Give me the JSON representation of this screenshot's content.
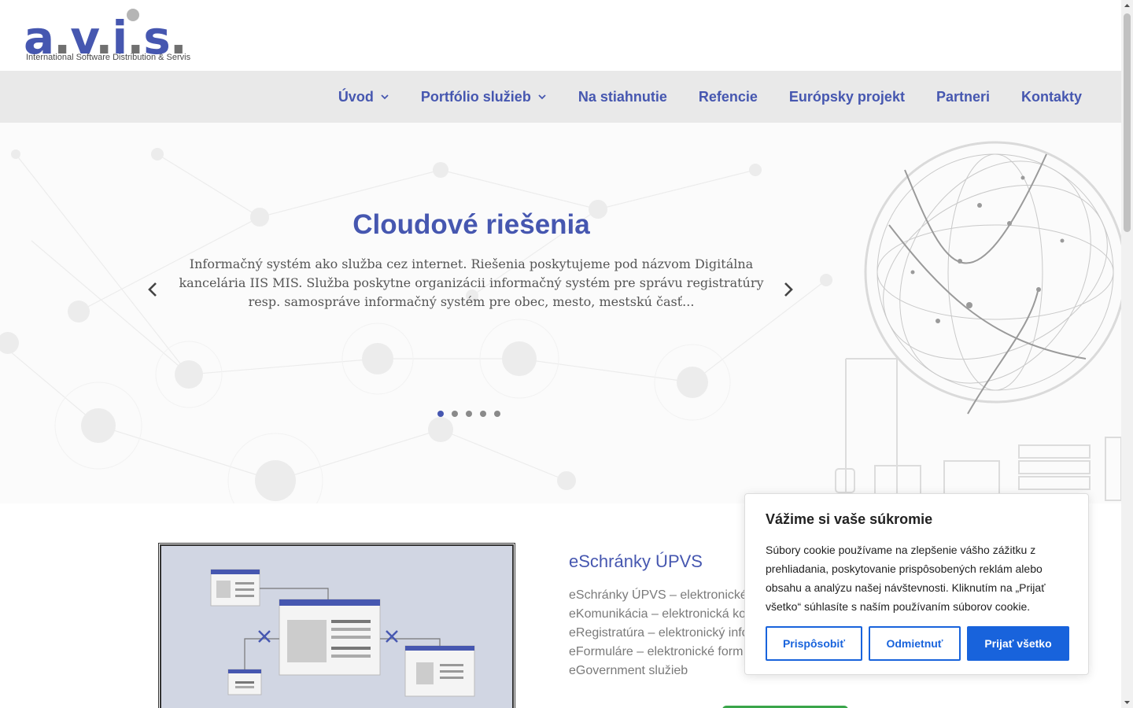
{
  "logo": {
    "letters": [
      "a",
      ".",
      "v",
      ".",
      "i",
      ".",
      "s",
      "."
    ],
    "tagline": "International Software Distribution & Servis"
  },
  "nav": {
    "items": [
      {
        "label": "Úvod",
        "dropdown": true
      },
      {
        "label": "Portfólio služieb",
        "dropdown": true
      },
      {
        "label": "Na stiahnutie",
        "dropdown": false
      },
      {
        "label": "Refencie",
        "dropdown": false
      },
      {
        "label": "Európsky projekt",
        "dropdown": false
      },
      {
        "label": "Partneri",
        "dropdown": false
      },
      {
        "label": "Kontakty",
        "dropdown": false
      }
    ]
  },
  "hero": {
    "title": "Cloudové riešenia",
    "text": "Informačný systém ako služba cez internet. Riešenia poskytujeme pod názvom Digitálna kancelária IIS MIS. Služba poskytne organizácii informačný systém pre správu registratúry resp. samospráve informačný systém pre obec, mesto, mestskú časť...",
    "slides": 5,
    "active_slide": 0
  },
  "feature": {
    "title": "eSchránky ÚPVS",
    "lines": [
      "eSchránky ÚPVS – elektronické",
      "eKomunikácia – elektronická ko",
      "eRegistratúra – elektronický info",
      "eFormuláre – elektronické form",
      "eGovernment služieb"
    ]
  },
  "cookie": {
    "title": "Vážime si vaše súkromie",
    "text": "Súbory cookie používame na zlepšenie vášho zážitku z prehliadania, poskytovanie prispôsobených reklám alebo obsahu a analýzu našej návštevnosti. Kliknutím na „Prijať všetko“ súhlasíte s naším používaním súborov cookie.",
    "customize": "Prispôsobiť",
    "reject": "Odmietnuť",
    "accept": "Prijať všetko"
  },
  "colors": {
    "brand": "#4657b0",
    "cookie_accent": "#1863dc",
    "nav_bg": "#e9e9e9"
  }
}
